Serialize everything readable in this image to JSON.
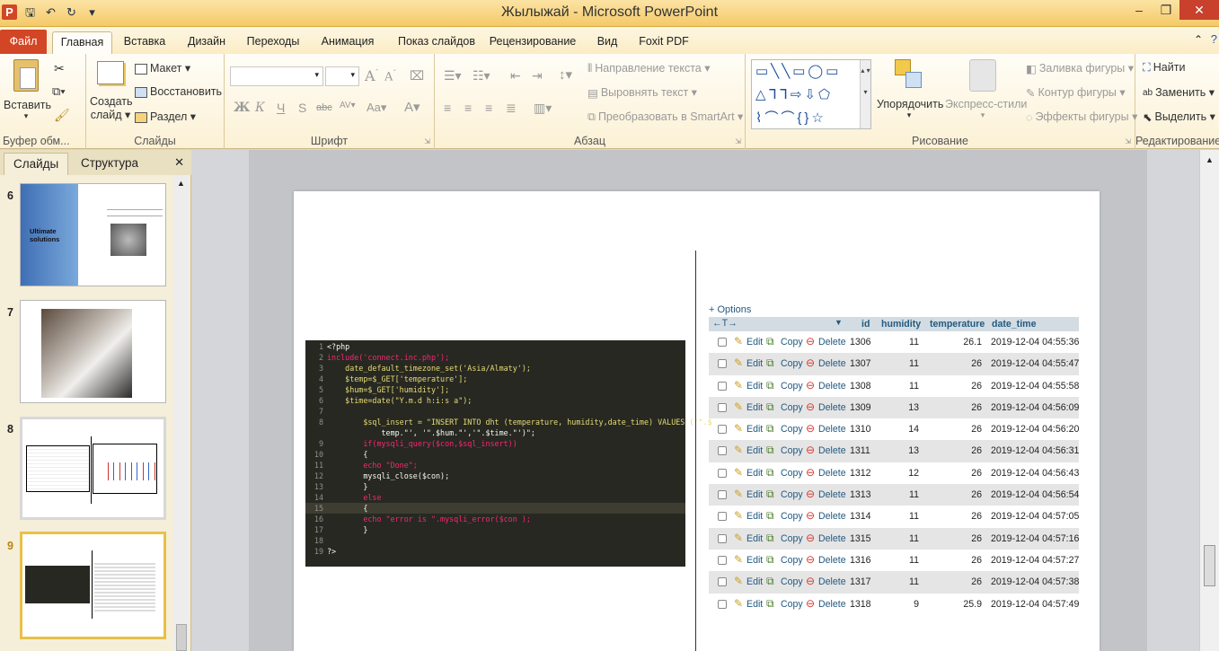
{
  "window": {
    "title": "Жылыжай - Microsoft PowerPoint"
  },
  "tabs": [
    "Файл",
    "Главная",
    "Вставка",
    "Дизайн",
    "Переходы",
    "Анимация",
    "Показ слайдов",
    "Рецензирование",
    "Вид",
    "Foxit PDF"
  ],
  "ribbon": {
    "clipboard": {
      "paste": "Вставить",
      "label": "Буфер обм..."
    },
    "slides": {
      "create1": "Создать",
      "create2": "слайд",
      "layout": "Макет",
      "reset": "Восстановить",
      "section": "Раздел",
      "label": "Слайды"
    },
    "font": {
      "label": "Шрифт",
      "bold": "Ж",
      "italic": "К",
      "underline": "Ч",
      "strike": "abc",
      "spacing": "AV",
      "case": "Aa"
    },
    "paragraph": {
      "label": "Абзац",
      "direction": "Направление текста",
      "align": "Выровнять текст",
      "smartart": "Преобразовать в SmartArt"
    },
    "drawing": {
      "arrange": "Упорядочить",
      "styles": "Экспресс-стили",
      "fill": "Заливка фигуры",
      "outline": "Контур фигуры",
      "effects": "Эффекты фигуры",
      "label": "Рисование"
    },
    "editing": {
      "find": "Найти",
      "replace": "Заменить",
      "select": "Выделить",
      "label": "Редактирование"
    }
  },
  "panel": {
    "tab_slides": "Слайды",
    "tab_outline": "Структура",
    "close": "✕",
    "thumbs": [
      {
        "num": "6",
        "text1": "Ultimate",
        "text2": "solutions"
      },
      {
        "num": "7"
      },
      {
        "num": "8"
      },
      {
        "num": "9"
      }
    ]
  },
  "code": [
    {
      "n": "1",
      "t": "<?php"
    },
    {
      "n": "2",
      "t": "include('connect.inc.php');"
    },
    {
      "n": "3",
      "t": "    date_default_timezone_set('Asia/Almaty');"
    },
    {
      "n": "4",
      "t": "    $temp=$_GET['temperature'];"
    },
    {
      "n": "5",
      "t": "    $hum=$_GET['humidity'];"
    },
    {
      "n": "6",
      "t": "    $time=date(\"Y.m.d h:i:s a\");"
    },
    {
      "n": "7",
      "t": ""
    },
    {
      "n": "8",
      "t": "        $sql_insert = \"INSERT INTO dht (temperature, humidity,date_time) VALUES ('\".$"
    },
    {
      "n": "",
      "t": "            temp.\"', '\".$hum.\"','\".$time.\"')\";"
    },
    {
      "n": "9",
      "t": "        if(mysqli_query($con,$sql_insert))"
    },
    {
      "n": "10",
      "t": "        {"
    },
    {
      "n": "11",
      "t": "        echo \"Done\";"
    },
    {
      "n": "12",
      "t": "        mysqli_close($con);"
    },
    {
      "n": "13",
      "t": "        }"
    },
    {
      "n": "14",
      "t": "        else"
    },
    {
      "n": "15",
      "t": "        {"
    },
    {
      "n": "16",
      "t": "        echo \"error is \".mysqli_error($con );"
    },
    {
      "n": "17",
      "t": "        }"
    },
    {
      "n": "18",
      "t": ""
    },
    {
      "n": "19",
      "t": "?>"
    }
  ],
  "table": {
    "options": "+ Options",
    "headers": {
      "id": "id",
      "humidity": "humidity",
      "temperature": "temperature",
      "date_time": "date_time"
    },
    "actions": {
      "edit": "Edit",
      "copy": "Copy",
      "delete": "Delete"
    },
    "rows": [
      {
        "id": "1306",
        "h": "11",
        "t": "26.1",
        "d": "2019-12-04 04:55:36"
      },
      {
        "id": "1307",
        "h": "11",
        "t": "26",
        "d": "2019-12-04 04:55:47"
      },
      {
        "id": "1308",
        "h": "11",
        "t": "26",
        "d": "2019-12-04 04:55:58"
      },
      {
        "id": "1309",
        "h": "13",
        "t": "26",
        "d": "2019-12-04 04:56:09"
      },
      {
        "id": "1310",
        "h": "14",
        "t": "26",
        "d": "2019-12-04 04:56:20"
      },
      {
        "id": "1311",
        "h": "13",
        "t": "26",
        "d": "2019-12-04 04:56:31"
      },
      {
        "id": "1312",
        "h": "12",
        "t": "26",
        "d": "2019-12-04 04:56:43"
      },
      {
        "id": "1313",
        "h": "11",
        "t": "26",
        "d": "2019-12-04 04:56:54"
      },
      {
        "id": "1314",
        "h": "11",
        "t": "26",
        "d": "2019-12-04 04:57:05"
      },
      {
        "id": "1315",
        "h": "11",
        "t": "26",
        "d": "2019-12-04 04:57:16"
      },
      {
        "id": "1316",
        "h": "11",
        "t": "26",
        "d": "2019-12-04 04:57:27"
      },
      {
        "id": "1317",
        "h": "11",
        "t": "26",
        "d": "2019-12-04 04:57:38"
      },
      {
        "id": "1318",
        "h": "9",
        "t": "25.9",
        "d": "2019-12-04 04:57:49"
      }
    ]
  }
}
